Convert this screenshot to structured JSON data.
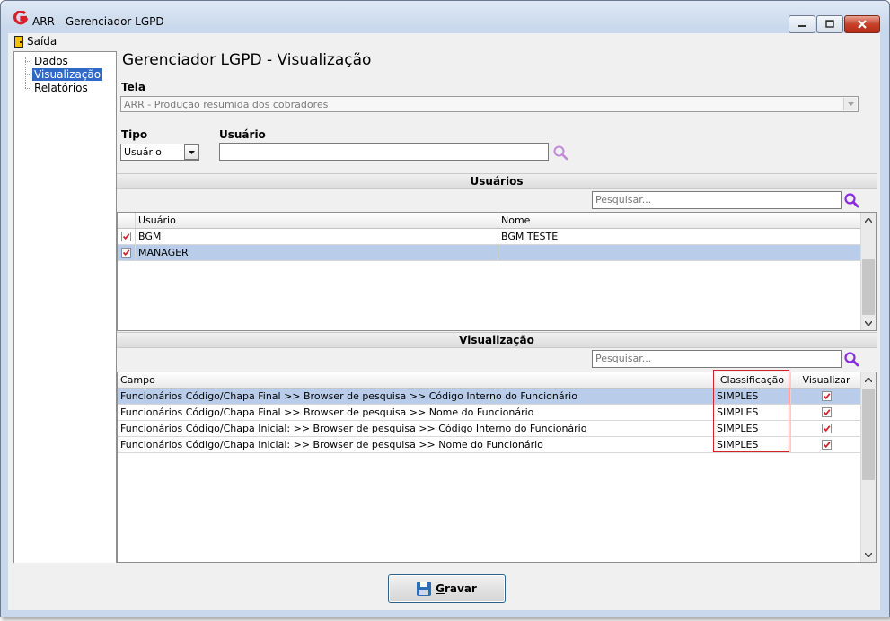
{
  "window": {
    "title": "ARR - Gerenciador LGPD",
    "controls": [
      "minimize-icon",
      "maximize-icon",
      "close-icon"
    ]
  },
  "menu": {
    "exit_label": "Saída"
  },
  "tree": {
    "items": [
      {
        "label": "Dados",
        "selected": false
      },
      {
        "label": "Visualização",
        "selected": true
      },
      {
        "label": "Relatórios",
        "selected": false
      }
    ]
  },
  "header": {
    "title": "Gerenciador LGPD - Visualização"
  },
  "form": {
    "tela_label": "Tela",
    "tela_value": "ARR - Produção resumida dos cobradores",
    "tipo_label": "Tipo",
    "tipo_value": "Usuário",
    "usuario_label": "Usuário",
    "usuario_value": ""
  },
  "usuarios": {
    "section_title": "Usuários",
    "search_placeholder": "Pesquisar...",
    "columns": [
      "Usuário",
      "Nome"
    ],
    "rows": [
      {
        "checked": true,
        "usuario": "BGM",
        "nome": "BGM TESTE",
        "selected": false
      },
      {
        "checked": true,
        "usuario": "MANAGER",
        "nome": "",
        "selected": true
      }
    ]
  },
  "visualizacao": {
    "section_title": "Visualização",
    "search_placeholder": "Pesquisar...",
    "columns": [
      "Campo",
      "Classificação",
      "Visualizar"
    ],
    "rows": [
      {
        "campo": "Funcionários Código/Chapa Final >> Browser de pesquisa >> Código Interno do Funcionário",
        "classificacao": "SIMPLES",
        "visualizar": true,
        "selected": true
      },
      {
        "campo": "Funcionários Código/Chapa Final >> Browser de pesquisa >> Nome do Funcionário",
        "classificacao": "SIMPLES",
        "visualizar": true,
        "selected": false
      },
      {
        "campo": "Funcionários Código/Chapa Inicial: >> Browser de pesquisa >> Código Interno do Funcionário",
        "classificacao": "SIMPLES",
        "visualizar": true,
        "selected": false
      },
      {
        "campo": "Funcionários Código/Chapa Inicial: >> Browser de pesquisa >> Nome do Funcionário",
        "classificacao": "SIMPLES",
        "visualizar": true,
        "selected": false
      }
    ]
  },
  "footer": {
    "save_label": "Gravar"
  },
  "colors": {
    "selection": "#b9cdea",
    "tree_selection": "#3169c6",
    "highlight_box": "#d2232a",
    "check": "#d2232a",
    "search_icon": "#8a2be2"
  }
}
